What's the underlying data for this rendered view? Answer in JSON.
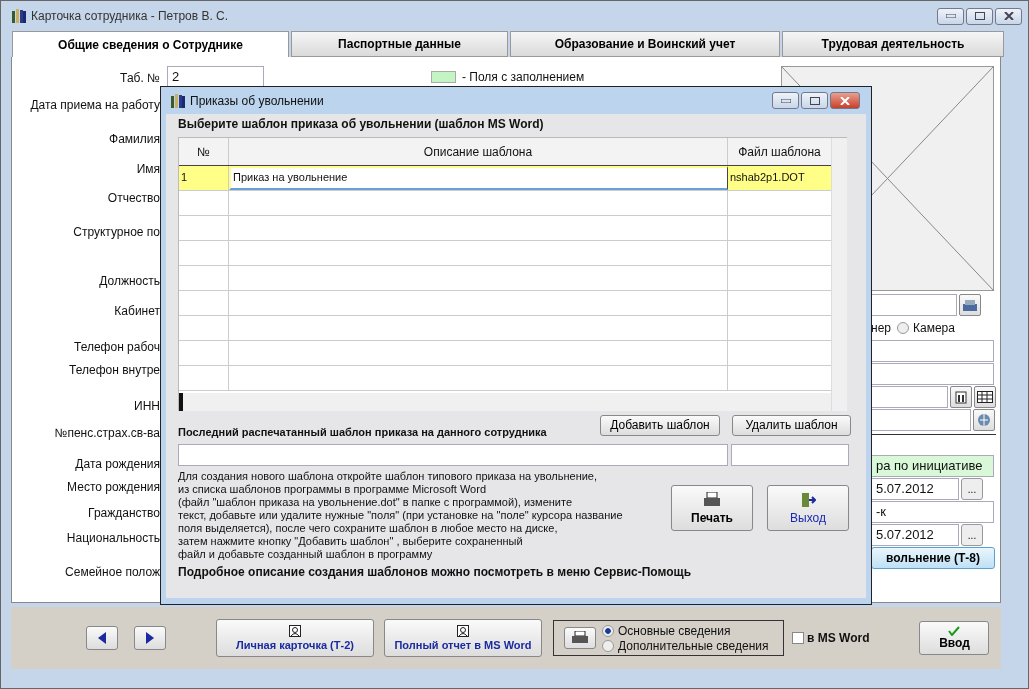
{
  "window": {
    "title": "Карточка сотрудника -  Петров В. С."
  },
  "tabs": [
    {
      "label": "Общие сведения о Сотруднике",
      "selected": true
    },
    {
      "label": "Паспортные данные",
      "selected": false
    },
    {
      "label": "Образование и Воинский учет",
      "selected": false
    },
    {
      "label": "Трудовая деятельность",
      "selected": false
    }
  ],
  "form": {
    "labels": [
      "Таб. №",
      "Дата приема на работу",
      "Фамилия",
      "Имя",
      "Отчество",
      "Структурное по",
      "Должность",
      "Кабинет",
      "Телефон рабоч",
      "Телефон внутре",
      "ИНН",
      "№пенс.страх.св-ва",
      "Дата рождения",
      "Место рождения",
      "Гражданство",
      "Национальность",
      "Семейное полож"
    ],
    "tab_number": "2",
    "legend": "-  Поля с заполнением"
  },
  "right_panel": {
    "photo_source": [
      {
        "label": "нер"
      },
      {
        "label": "Камера",
        "selected": false
      }
    ],
    "dismissal_reason": "ра по инициативе",
    "dismissal_date": "5.07.2012",
    "order_number": "-к",
    "order_date": "5.07.2012",
    "date_buttons": [
      "...",
      "..."
    ],
    "order_button": "вольнение (Т-8)"
  },
  "dialog": {
    "title": "Приказы об увольнении",
    "heading": "Выберите шаблон приказа об увольнении (шаблон MS Word)",
    "table": {
      "columns": [
        "№",
        "Описание шаблона",
        "Файл шаблона"
      ],
      "rows": [
        {
          "number": "1",
          "description": "Приказ на увольнение",
          "file": "nshab2p1.DOT",
          "selected": true
        }
      ]
    },
    "last_printed_label": "Последний распечатанный шаблон приказа на  данного сотрудника",
    "add_button": "Добавить шаблон",
    "delete_button": "Удалить шаблон",
    "instructions": "Для создания нового шаблона откройте шаблон типового приказа на увольнение,\nиз списка шаблонов программы в программе Microsoft Word\n(файл \"шаблон приказа на увольнение.dot\" в папке  с программой),  измените\nтекст, добавьте или удалите нужные \"поля\" (при установке на \"поле\" курсора название\nполя выделяется), после чего сохраните шаблон в любое место на диске,\nзатем нажмите кнопку \"Добавить шаблон\" , выберите сохраненный\nфайл и добавьте созданный шаблон в программу",
    "help_note": "Подробное описание создания шаблонов можно посмотреть в меню Сервис-Помощь",
    "print_button": "Печать",
    "exit_button": "Выход"
  },
  "bottom_bar": {
    "personal_card_button": "Личная карточка (Т-2)",
    "full_report_button": "Полный отчет в MS Word",
    "print_options": [
      {
        "label": "Основные сведения",
        "selected": true
      },
      {
        "label": "Дополнительные сведения",
        "selected": false
      }
    ],
    "ms_word": {
      "label": "в MS Word",
      "checked": false
    },
    "enter_button": "Ввод"
  }
}
